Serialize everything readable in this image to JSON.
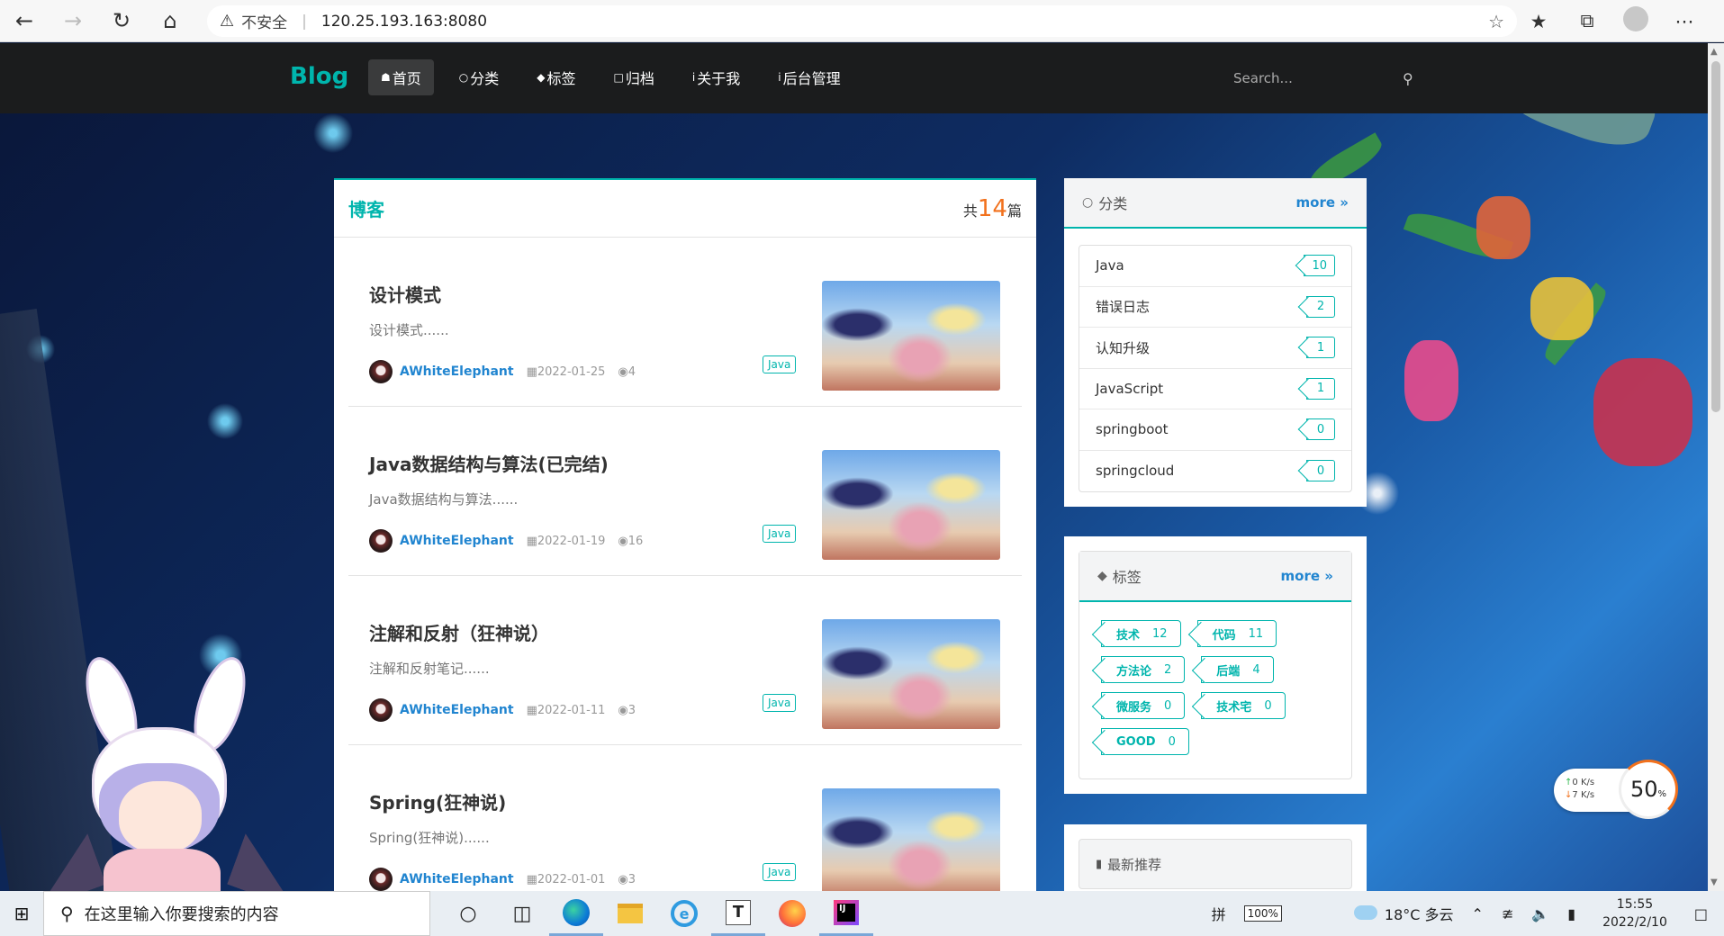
{
  "browser": {
    "insecure_label": "不安全",
    "url": "120.25.193.163:8080"
  },
  "site": {
    "brand": "Blog",
    "menu": [
      {
        "label": "首页",
        "icon": "home-icon"
      },
      {
        "label": "分类",
        "icon": "idea-icon"
      },
      {
        "label": "标签",
        "icon": "tags-icon"
      },
      {
        "label": "归档",
        "icon": "clone-icon"
      },
      {
        "label": "关于我",
        "icon": "info-icon"
      },
      {
        "label": "后台管理",
        "icon": "info-icon"
      }
    ],
    "search_placeholder": "Search..."
  },
  "main": {
    "title": "博客",
    "count_prefix": "共",
    "count": "14",
    "count_suffix": "篇",
    "posts": [
      {
        "title": "设计模式",
        "desc": "设计模式......",
        "author": "AWhiteElephant",
        "date": "2022-01-25",
        "views": "4",
        "tag": "Java"
      },
      {
        "title": "Java数据结构与算法(已完结)",
        "desc": "Java数据结构与算法......",
        "author": "AWhiteElephant",
        "date": "2022-01-19",
        "views": "16",
        "tag": "Java"
      },
      {
        "title": "注解和反射（狂神说）",
        "desc": "注解和反射笔记......",
        "author": "AWhiteElephant",
        "date": "2022-01-11",
        "views": "3",
        "tag": "Java"
      },
      {
        "title": "Spring(狂神说)",
        "desc": "Spring(狂神说)......",
        "author": "AWhiteElephant",
        "date": "2022-01-01",
        "views": "3",
        "tag": "Java"
      }
    ]
  },
  "sidebar": {
    "categories": {
      "title": "分类",
      "more": "more",
      "items": [
        {
          "name": "Java",
          "count": "10"
        },
        {
          "name": "错误日志",
          "count": "2"
        },
        {
          "name": "认知升级",
          "count": "1"
        },
        {
          "name": "JavaScript",
          "count": "1"
        },
        {
          "name": "springboot",
          "count": "0"
        },
        {
          "name": "springcloud",
          "count": "0"
        }
      ]
    },
    "tags": {
      "title": "标签",
      "more": "more",
      "items": [
        {
          "name": "技术",
          "count": "12"
        },
        {
          "name": "代码",
          "count": "11"
        },
        {
          "name": "方法论",
          "count": "2"
        },
        {
          "name": "后端",
          "count": "4"
        },
        {
          "name": "微服务",
          "count": "0"
        },
        {
          "name": "技术宅",
          "count": "0"
        },
        {
          "name": "GOOD",
          "count": "0"
        }
      ]
    },
    "recommend": {
      "title": "最新推荐"
    }
  },
  "speed_widget": {
    "up": "0",
    "down": "7",
    "unit": "K/s",
    "percent": "50",
    "percent_sign": "%"
  },
  "taskbar": {
    "search_placeholder": "在这里输入你要搜索的内容",
    "ime": "拼",
    "battery": "100%",
    "weather": "18°C 多云",
    "time": "15:55",
    "date": "2022/2/10"
  },
  "colors": {
    "accent": "#00b5ad",
    "link": "#2185d0",
    "orange": "#f2711c",
    "nav_bg": "#1b1c1d"
  }
}
